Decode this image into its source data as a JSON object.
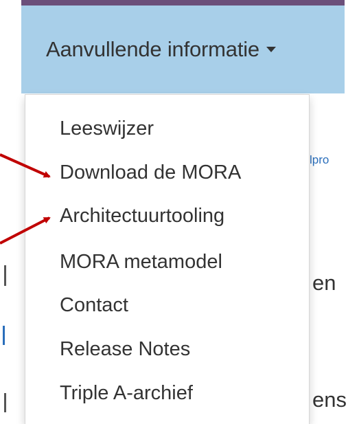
{
  "nav": {
    "label": "Aanvullende informatie",
    "caret_icon": "caret-down-icon"
  },
  "background": {
    "link_fragment": "lpro",
    "text_fragment_1": "en",
    "text_fragment_2": "ens"
  },
  "dropdown": {
    "items": [
      {
        "label": "Leeswijzer"
      },
      {
        "label": "Download de MORA"
      },
      {
        "label": "Architectuurtooling"
      },
      {
        "label": "MORA metamodel"
      },
      {
        "label": "Contact"
      },
      {
        "label": "Release Notes"
      },
      {
        "label": "Triple A-archief"
      }
    ]
  },
  "colors": {
    "nav_background": "#a8cfe9",
    "top_border": "#6b4f7a",
    "annotation_arrow": "#c00000",
    "text": "#333333",
    "link": "#2a6ebb"
  },
  "annotations": {
    "arrow_icon": "red-arrow-icon"
  }
}
